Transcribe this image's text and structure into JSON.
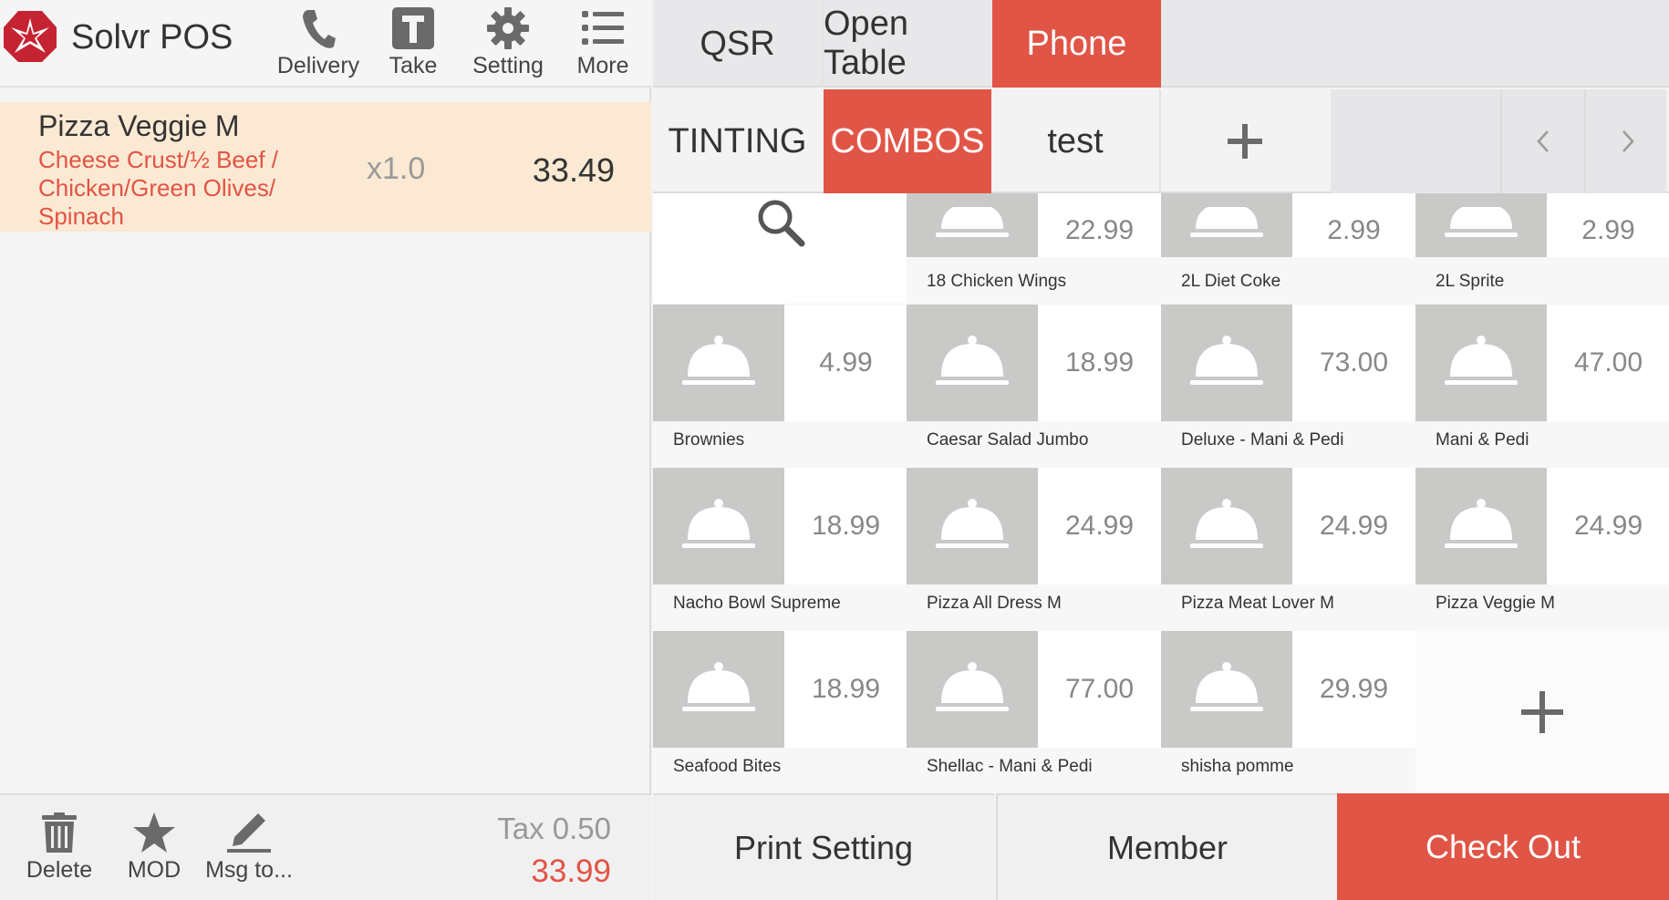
{
  "app": {
    "title": "Solvr POS"
  },
  "toolbar": {
    "delivery_label": "Delivery",
    "take_label": "Take",
    "setting_label": "Setting",
    "more_label": "More"
  },
  "order": {
    "item_name": "Pizza Veggie M",
    "modifiers": "Cheese Crust/½ Beef / Chicken/Green Olives/ Spinach",
    "quantity": "x1.0",
    "price": "33.49"
  },
  "order_actions": {
    "delete_label": "Delete",
    "mod_label": "MOD",
    "msg_label": "Msg to..."
  },
  "totals": {
    "tax": "Tax 0.50",
    "total": "33.99"
  },
  "order_modes": [
    {
      "label": "QSR",
      "active": false
    },
    {
      "label": "Open Table",
      "active": false
    },
    {
      "label": "Phone",
      "active": true
    }
  ],
  "categories": [
    {
      "label": "TINTING",
      "active": false
    },
    {
      "label": "COMBOS",
      "active": true
    },
    {
      "label": "test",
      "active": false
    }
  ],
  "menu_items_partial": [
    {
      "name": "18 Chicken Wings",
      "price": "22.99"
    },
    {
      "name": "2L Diet Coke",
      "price": "2.99"
    },
    {
      "name": "2L Sprite",
      "price": "2.99"
    }
  ],
  "menu_items": [
    {
      "name": "Brownies",
      "price": "4.99"
    },
    {
      "name": "Caesar Salad Jumbo",
      "price": "18.99"
    },
    {
      "name": "Deluxe - Mani & Pedi",
      "price": "73.00"
    },
    {
      "name": "Mani & Pedi",
      "price": "47.00"
    },
    {
      "name": "Nacho Bowl Supreme",
      "price": "18.99"
    },
    {
      "name": "Pizza All Dress M",
      "price": "24.99"
    },
    {
      "name": "Pizza Meat Lover M",
      "price": "24.99"
    },
    {
      "name": "Pizza Veggie M",
      "price": "24.99"
    },
    {
      "name": "Seafood Bites",
      "price": "18.99"
    },
    {
      "name": "Shellac - Mani & Pedi",
      "price": "77.00"
    },
    {
      "name": "shisha pomme",
      "price": "29.99"
    }
  ],
  "bottom_actions": {
    "print_setting": "Print Setting",
    "member": "Member",
    "check_out": "Check Out"
  },
  "colors": {
    "accent": "#e05546",
    "highlight": "#fce9d3",
    "thumb": "#c9cac8"
  }
}
